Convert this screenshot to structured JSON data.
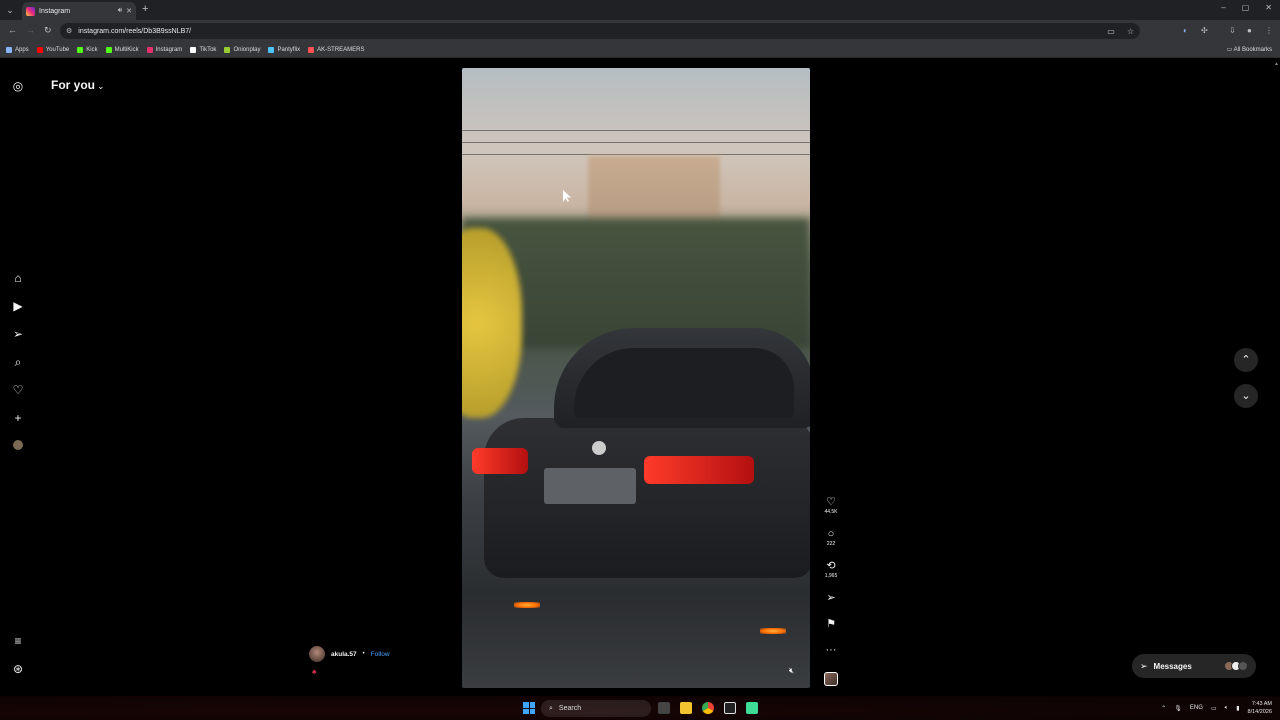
{
  "browser": {
    "tab_title": "Instagram",
    "new_tab": "+",
    "url": "instagram.com/reels/Db3B9ssNLB7/",
    "window_controls": [
      "–",
      "▢",
      "✕"
    ],
    "bookmarks": [
      {
        "label": "Apps",
        "color": "#8ab4f8"
      },
      {
        "label": "YouTube",
        "color": "#ff0000"
      },
      {
        "label": "Kick",
        "color": "#53fc18"
      },
      {
        "label": "MultiKick",
        "color": "#53fc18"
      },
      {
        "label": "Instagram",
        "color": "#e1306c"
      },
      {
        "label": "TikTok",
        "color": "#ffffff"
      },
      {
        "label": "Onionplay",
        "color": "#9acd32"
      },
      {
        "label": "Pantyflix",
        "color": "#4fc3f7"
      },
      {
        "label": "AK-STREAMERS",
        "color": "#ff5252"
      }
    ],
    "all_bookmarks": "All Bookmarks"
  },
  "instagram": {
    "feed_selector": "For you",
    "author": {
      "username": "akula.57",
      "separator": "•",
      "follow": "Follow"
    },
    "actions": {
      "likes": "44.5K",
      "comments": "222",
      "reposts": "1,965"
    },
    "messages_label": "Messages",
    "sidebar_icons": [
      "instagram-logo-icon",
      "home-icon",
      "reels-icon",
      "send-icon",
      "search-icon",
      "heart-icon",
      "create-icon",
      "profile-avatar",
      "menu-icon",
      "threads-icon"
    ]
  },
  "taskbar": {
    "search_placeholder": "Search",
    "language": "ENG",
    "time": "7:43 AM",
    "date": "8/14/2026"
  }
}
